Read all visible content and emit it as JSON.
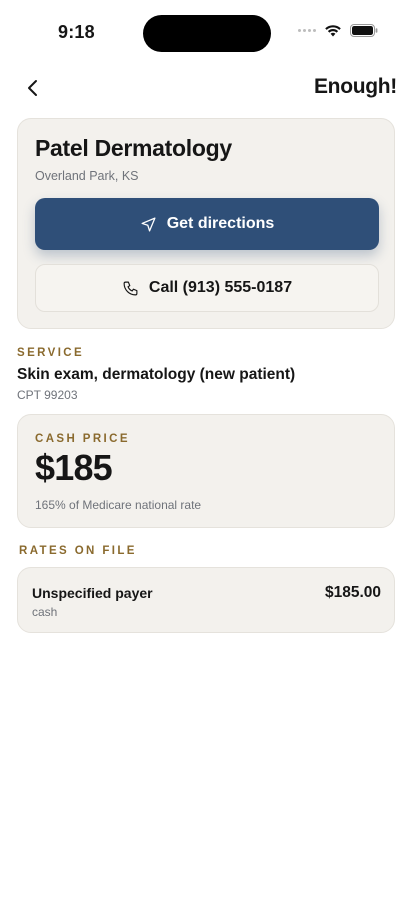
{
  "status_bar": {
    "time": "9:18"
  },
  "nav": {
    "brand": "Enough!"
  },
  "provider": {
    "name": "Patel Dermatology",
    "location": "Overland Park, KS",
    "directions_label": "Get directions",
    "call_label": "Call (913) 555-0187"
  },
  "service": {
    "section_label": "SERVICE",
    "name": "Skin exam, dermatology (new patient)",
    "code": "CPT 99203"
  },
  "cash_price": {
    "label": "CASH PRICE",
    "value": "$185",
    "note": "165% of Medicare national rate"
  },
  "rates": {
    "section_label": "RATES ON FILE",
    "items": [
      {
        "payer": "Unspecified payer",
        "type": "cash",
        "amount": "$185.00"
      }
    ]
  },
  "colors": {
    "accent_button": "#2f4f78",
    "label_gold": "#8a6a2e",
    "card_bg": "#f3f1ed"
  },
  "icons": {
    "back": "chevron-left-icon",
    "directions": "navigation-arrow-icon",
    "call": "phone-icon",
    "wifi": "wifi-icon",
    "battery": "battery-icon",
    "signal": "cellular-signal-icon"
  }
}
